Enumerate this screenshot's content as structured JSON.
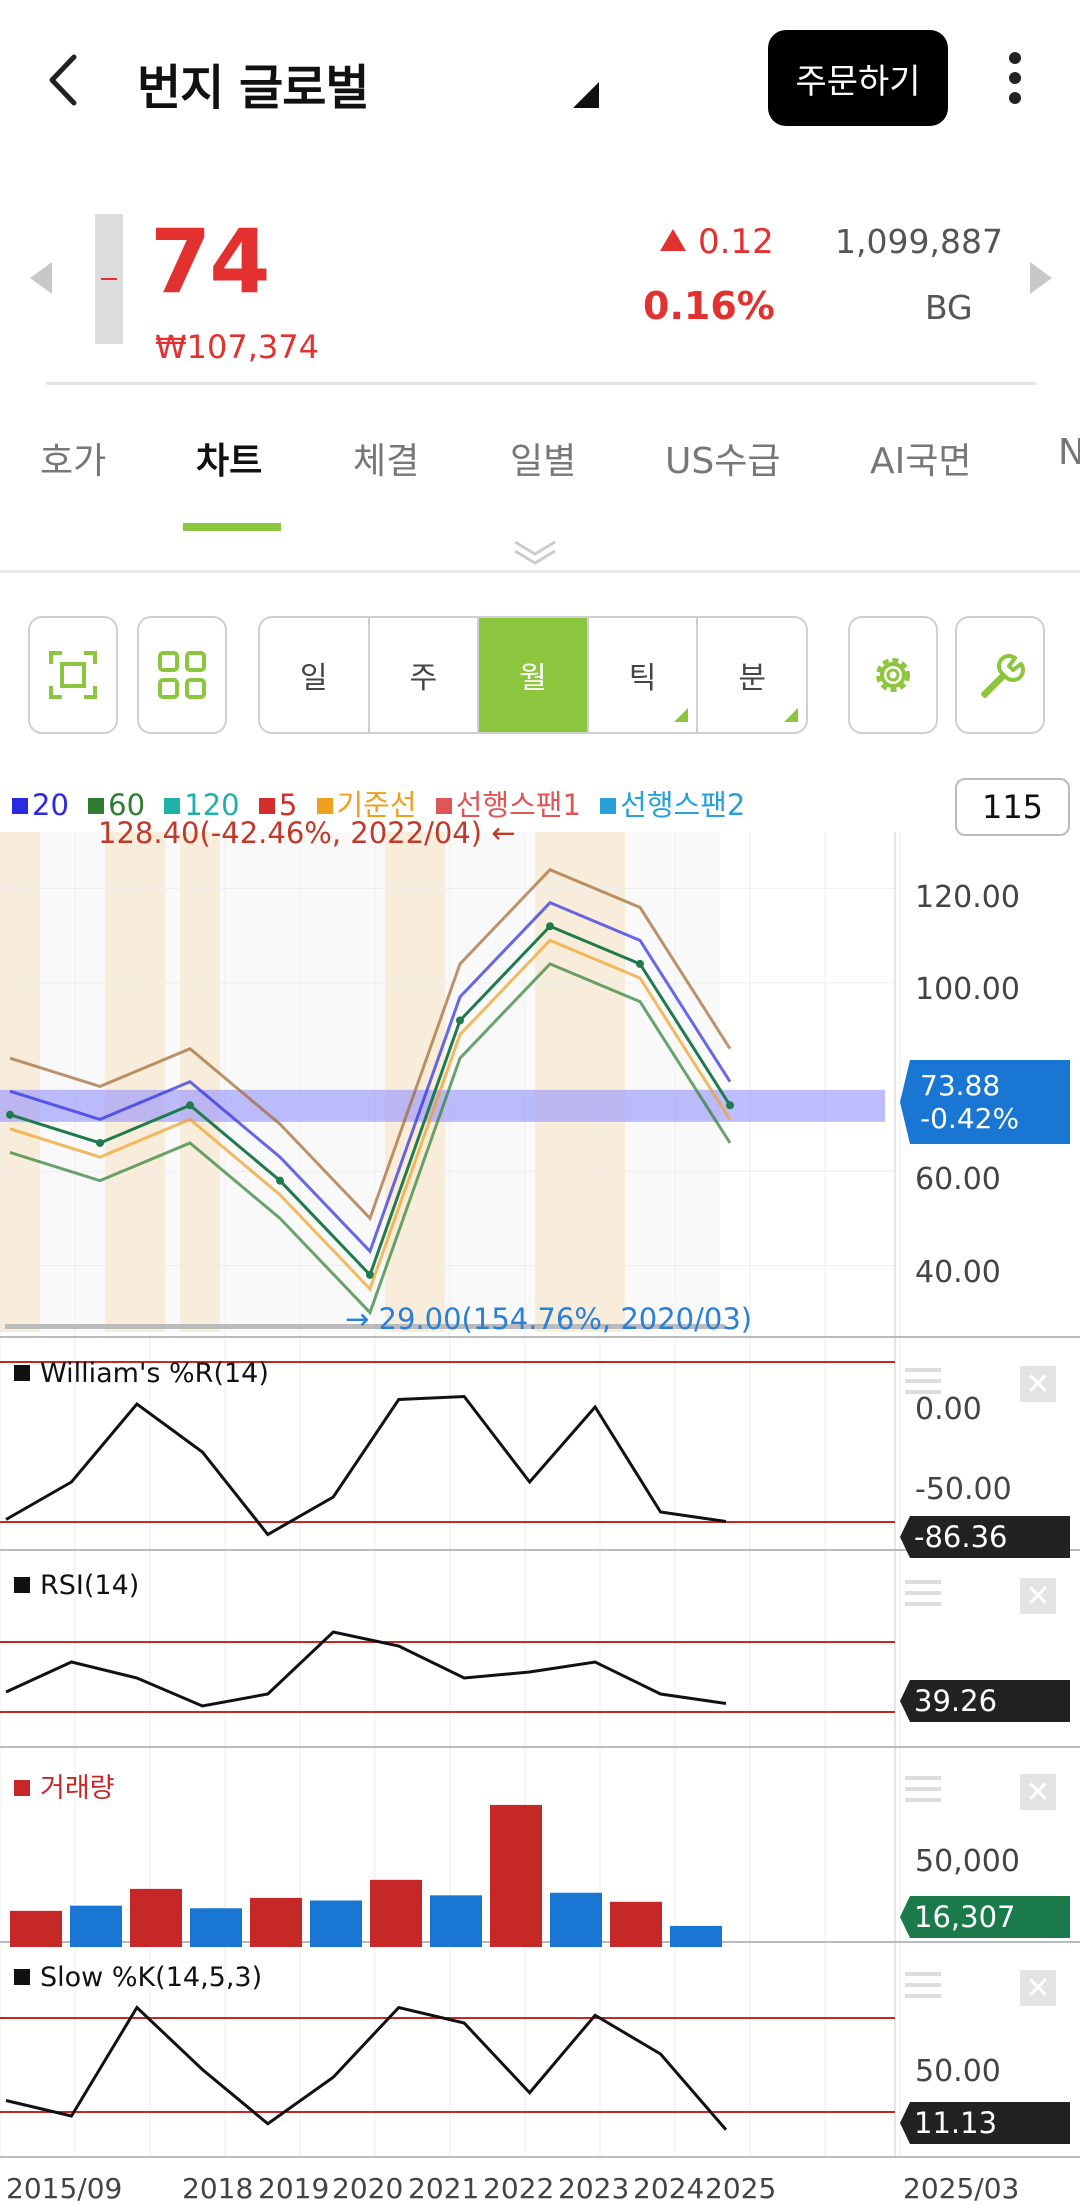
{
  "header": {
    "title": "번지 글로벌",
    "order_button": "주문하기"
  },
  "quote": {
    "price": "74",
    "price_krw": "₩107,374",
    "change": "0.12",
    "change_pct": "0.16%",
    "volume": "1,099,887",
    "symbol": "BG",
    "color_up": "#e2312f"
  },
  "tabs": [
    {
      "label": "호가"
    },
    {
      "label": "차트",
      "active": true
    },
    {
      "label": "체결"
    },
    {
      "label": "일별"
    },
    {
      "label": "US수급"
    },
    {
      "label": "AI국면"
    },
    {
      "label": "N"
    }
  ],
  "toolbar": {
    "periods": [
      {
        "label": "일"
      },
      {
        "label": "주"
      },
      {
        "label": "월",
        "active": true
      },
      {
        "label": "틱"
      },
      {
        "label": "분"
      }
    ],
    "accent_color": "#8cc63f"
  },
  "chart": {
    "legend": [
      {
        "label": "20",
        "color": "#2a2ae0"
      },
      {
        "label": "60",
        "color": "#2e7d32"
      },
      {
        "label": "120",
        "color": "#20b2aa"
      },
      {
        "label": "5",
        "color": "#d32f2f"
      },
      {
        "label": "기준선",
        "color": "#f0a020"
      },
      {
        "label": "선행스팬1",
        "color": "#e05555"
      },
      {
        "label": "선행스팬2",
        "color": "#2aa0d8"
      }
    ],
    "count": "115",
    "high_label": "128.40(-42.46%, 2022/04)",
    "low_label": "29.00(154.76%, 2020/03)",
    "price_axis": [
      "120.00",
      "100.00",
      "60.00",
      "40.00"
    ],
    "current_tag": {
      "value": "73.88",
      "pct": "-0.42%"
    },
    "x_axis": [
      "2015/09",
      "2018",
      "2019",
      "2020",
      "2021",
      "2022",
      "2023",
      "2024",
      "2025",
      "2025/03"
    ],
    "panels": {
      "williams": {
        "title": "William's %R(14)",
        "axis": [
          "0.00",
          "-50.00"
        ],
        "value": "-86.36"
      },
      "rsi": {
        "title": "RSI(14)",
        "value": "39.26"
      },
      "volume": {
        "title": "거래량",
        "axis": [
          "50,000"
        ],
        "value": "16,307"
      },
      "slowk": {
        "title": "Slow %K(14,5,3)",
        "axis": [
          "50.00"
        ],
        "value": "11.13"
      }
    }
  },
  "chart_data": [
    {
      "type": "line",
      "title": "",
      "x": [
        "2015/09",
        "2018",
        "2019",
        "2020",
        "2021",
        "2022",
        "2023",
        "2024",
        "2025"
      ],
      "ylim": [
        28,
        132
      ],
      "series": [
        {
          "values": [
            72,
            66,
            74,
            58,
            38,
            92,
            112,
            104,
            74
          ]
        }
      ],
      "annotations": [
        "128.40(-42.46%, 2022/04)",
        "29.00(154.76%, 2020/03)"
      ],
      "last": 73.88
    },
    {
      "type": "line",
      "title": "William's %R(14)",
      "ylim": [
        -100,
        0
      ],
      "series": [
        {
          "name": "William's %R(14)",
          "values": [
            -85,
            -60,
            -8,
            -40,
            -95,
            -70,
            -5,
            -3,
            -60,
            -10,
            -80,
            -86.36
          ]
        }
      ]
    },
    {
      "type": "line",
      "title": "RSI(14)",
      "series": [
        {
          "name": "RSI(14)",
          "values": [
            45,
            60,
            52,
            38,
            44,
            75,
            68,
            52,
            55,
            60,
            44,
            39.26
          ]
        }
      ]
    },
    {
      "type": "bar",
      "title": "거래량",
      "series": [
        {
          "name": "거래량",
          "values": [
            28000,
            32000,
            45000,
            30000,
            38000,
            36000,
            52000,
            40000,
            110000,
            42000,
            35000,
            16307
          ]
        }
      ]
    },
    {
      "type": "line",
      "title": "Slow %K(14,5,3)",
      "series": [
        {
          "name": "Slow %K(14,5,3)",
          "values": [
            30,
            20,
            90,
            50,
            15,
            45,
            90,
            80,
            35,
            85,
            60,
            11.13
          ]
        }
      ]
    }
  ]
}
